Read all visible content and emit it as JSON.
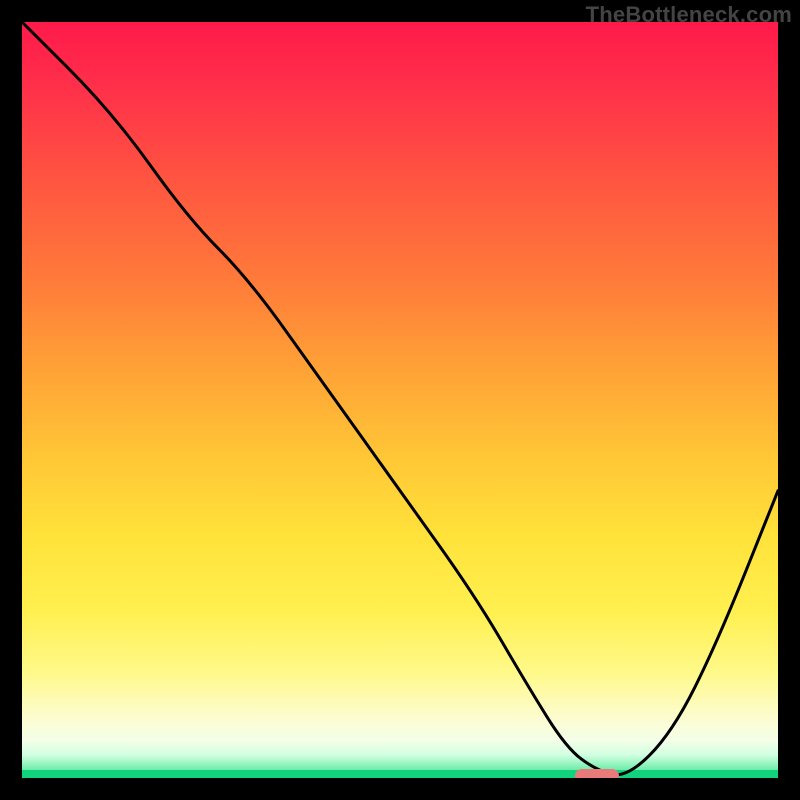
{
  "watermark": "TheBottleneck.com",
  "chart_data": {
    "type": "line",
    "title": "",
    "xlabel": "",
    "ylabel": "",
    "xlim": [
      0,
      100
    ],
    "ylim": [
      0,
      100
    ],
    "x": [
      0,
      12,
      22,
      30,
      40,
      50,
      60,
      67,
      72,
      76,
      80,
      86,
      92,
      100
    ],
    "values": [
      100,
      88,
      74,
      66,
      52,
      38,
      24,
      12,
      4,
      1,
      0,
      6,
      18,
      38
    ],
    "marker": {
      "x": 76,
      "y": 0
    },
    "annotations": []
  },
  "colors": {
    "marker": "#e97a7a",
    "curve": "#000000",
    "green_band": "#12d27e"
  }
}
